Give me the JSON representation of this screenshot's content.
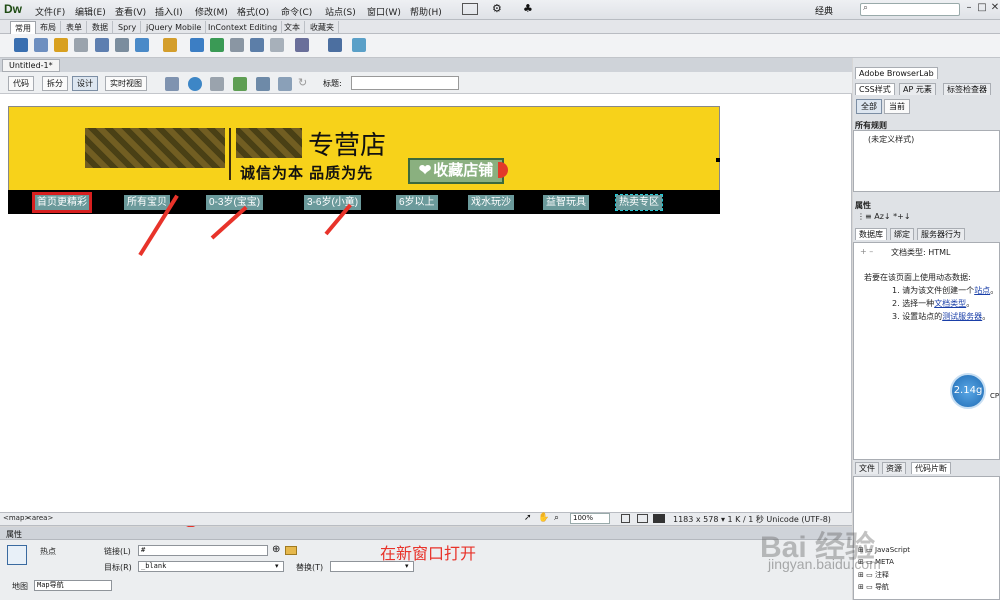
{
  "app": {
    "logo": "Dw",
    "workspace": "经典",
    "window_controls": [
      "–",
      "□",
      "✕"
    ]
  },
  "menu": [
    "文件(F)",
    "编辑(E)",
    "查看(V)",
    "插入(I)",
    "修改(M)",
    "格式(O)",
    "命令(C)",
    "站点(S)",
    "窗口(W)",
    "帮助(H)"
  ],
  "insert_tabs": [
    "常用",
    "布局",
    "表单",
    "数据",
    "Spry",
    "jQuery Mobile",
    "InContext Editing",
    "文本",
    "收藏夹"
  ],
  "document": {
    "tab": "Untitled-1*",
    "view_buttons": [
      "代码",
      "拆分",
      "设计",
      "实时视图"
    ],
    "title_label": "标题:"
  },
  "banner": {
    "store_suffix": "专营店",
    "slogan": "诚信为本  品质为先",
    "fav_button": "收藏店铺",
    "nav": [
      "首页更精彩",
      "所有宝贝",
      "0-3岁(宝宝)",
      "3-6岁(小童)",
      "6岁以上",
      "戏水玩沙",
      "益智玩具",
      "热卖专区"
    ]
  },
  "tagbar": {
    "tags": [
      "<map>",
      "<area>"
    ],
    "zoom": "100%",
    "status": "1183 x 578 ▾ 1 K / 1 秒  Unicode (UTF-8)"
  },
  "properties": {
    "header": "属性",
    "type": "热点",
    "link_label": "链接(L)",
    "link_value": "#",
    "target_label": "目标(R)",
    "target_value": "_blank",
    "alt_label": "替换(T)",
    "alt_value": "",
    "map_label": "地图",
    "map_value": "Map导航",
    "annotation": "在新窗口打开"
  },
  "right_panel": {
    "browserlab": "Adobe BrowserLab",
    "css_tabs": [
      "CSS样式",
      "AP 元素",
      "标签检查器"
    ],
    "css_modes": [
      "全部",
      "当前"
    ],
    "all_rules": "所有规则",
    "undefined_style": "(未定义样式)",
    "attributes": "属性",
    "data_tabs": [
      "数据库",
      "绑定",
      "服务器行为"
    ],
    "doc_type": "文档类型: HTML",
    "dynamic_intro": "若要在该页面上使用动态数据:",
    "steps": [
      {
        "n": "1.",
        "pre": "请为该文件创建一个",
        "link": "站点",
        "post": "。"
      },
      {
        "n": "2.",
        "pre": "选择一种",
        "link": "文档类型",
        "post": "。"
      },
      {
        "n": "3.",
        "pre": "设置站点的",
        "link": "测试服务器",
        "post": "。"
      }
    ],
    "cpu": "2.14g",
    "cpu_caption": "CP",
    "file_tabs": [
      "文件",
      "资源",
      "代码片断"
    ],
    "tree": [
      "JavaScript",
      "META",
      "注释",
      "导航"
    ]
  },
  "watermark": {
    "brand": "Bai 经验",
    "url": "jingyan.baidu.com"
  },
  "colors": {
    "banner": "#f7d21a",
    "nav_link": "#6b9a9b",
    "highlight": "#d71f1f",
    "annotation": "#e8332a"
  }
}
